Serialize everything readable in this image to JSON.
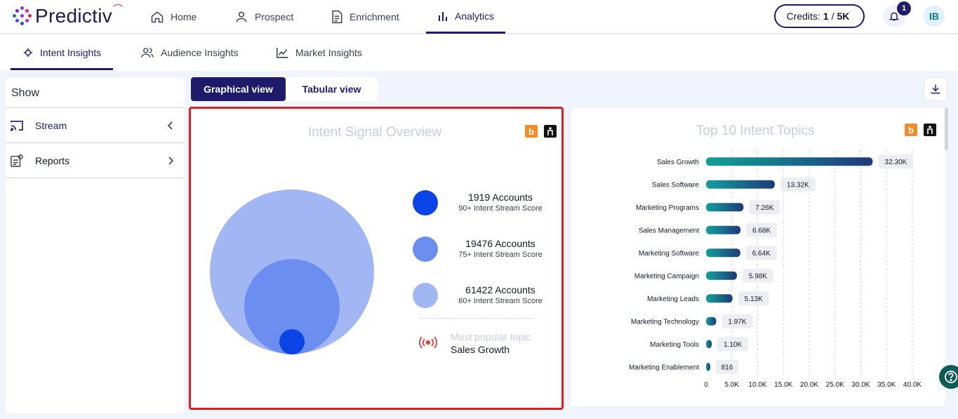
{
  "app": {
    "brand": "Predictiv"
  },
  "nav": {
    "items": [
      {
        "label": "Home",
        "icon": "home-icon"
      },
      {
        "label": "Prospect",
        "icon": "person-icon"
      },
      {
        "label": "Enrichment",
        "icon": "document-icon"
      },
      {
        "label": "Analytics",
        "icon": "bar-chart-icon",
        "active": true
      }
    ],
    "credits": {
      "label": "Credits:",
      "used": "1",
      "sep": "/",
      "total": "5K"
    },
    "notifications": "1",
    "user_initials": "IB"
  },
  "subtabs": [
    {
      "label": "Intent Insights",
      "active": true
    },
    {
      "label": "Audience Insights"
    },
    {
      "label": "Market Insights"
    }
  ],
  "sidebar": {
    "title": "Show",
    "items": [
      {
        "label": "Stream",
        "chevron": "left"
      },
      {
        "label": "Reports",
        "chevron": "right"
      }
    ]
  },
  "view_toggle": {
    "graphical": "Graphical view",
    "tabular": "Tabular view"
  },
  "intent_overview": {
    "title": "Intent Signal Overview",
    "badges": {
      "b": "b"
    },
    "legend": [
      {
        "accounts": "1919 Accounts",
        "score": "90+ Intent Stream Score",
        "color": "#0b44e6"
      },
      {
        "accounts": "19476 Accounts",
        "score": "75+ Intent Stream Score",
        "color": "#6b8ef0"
      },
      {
        "accounts": "61422 Accounts",
        "score": "60+ Intent Stream Score",
        "color": "#a2b6f4"
      }
    ],
    "popular_label": "Most popular topic",
    "popular_topic": "Sales Growth"
  },
  "chart_data": {
    "type": "bar",
    "orientation": "horizontal",
    "title": "Top 10 Intent Topics",
    "categories": [
      "Sales Growth",
      "Sales Software",
      "Marketing Programs",
      "Sales Management",
      "Marketing Software",
      "Marketing Campaign",
      "Marketing Leads",
      "Marketing Technology",
      "Marketing Tools",
      "Marketing Enablement"
    ],
    "values": [
      32300,
      13320,
      7260,
      6680,
      6640,
      5980,
      5130,
      1970,
      1100,
      816
    ],
    "data_labels": [
      "32.30K",
      "13.32K",
      "7.26K",
      "6.68K",
      "6.64K",
      "5.98K",
      "5.13K",
      "1.97K",
      "1.10K",
      "816"
    ],
    "xlim": [
      0,
      40000
    ],
    "x_ticks": [
      "0",
      "5.0K",
      "10.0K",
      "15.0K",
      "20.0K",
      "25.0K",
      "30.0K",
      "35.0K",
      "40.0K"
    ],
    "grid": true,
    "colors": {
      "start": "#14a09a",
      "end": "#1e3a7a"
    }
  }
}
